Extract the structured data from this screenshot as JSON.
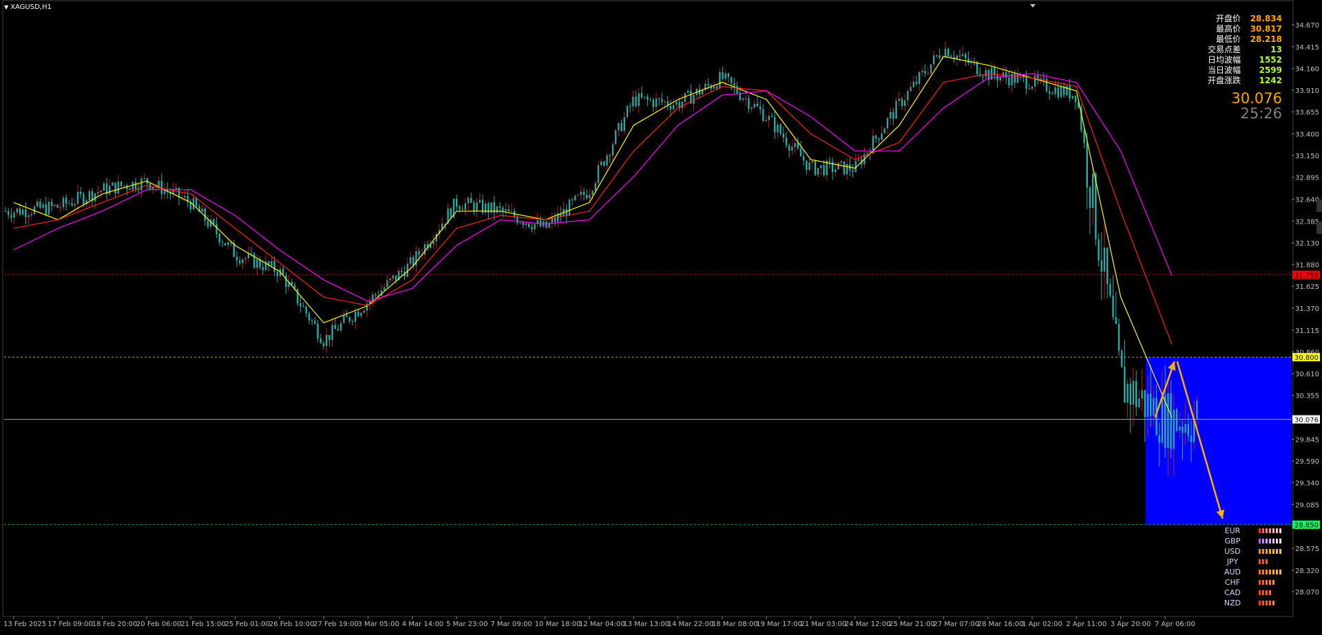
{
  "window": {
    "symbol_title": "XAGUSD,H1"
  },
  "info_panel": {
    "rows": [
      {
        "label": "开盘价",
        "value": "28.834",
        "tone": "orange"
      },
      {
        "label": "最高价",
        "value": "30.817",
        "tone": "orange"
      },
      {
        "label": "最低价",
        "value": "28.218",
        "tone": "orange"
      },
      {
        "label": "交易点差",
        "value": "13",
        "tone": "green"
      },
      {
        "label": "日均波幅",
        "value": "1552",
        "tone": "green"
      },
      {
        "label": "当日波幅",
        "value": "2599",
        "tone": "green"
      },
      {
        "label": "开盘涨跌",
        "value": "1242",
        "tone": "green"
      }
    ],
    "current_price": "30.076",
    "countdown": "25:26"
  },
  "price_axis": {
    "ticks": [
      "34.670",
      "34.415",
      "34.160",
      "33.910",
      "33.655",
      "33.400",
      "33.150",
      "32.895",
      "32.640",
      "32.385",
      "32.130",
      "31.880",
      "31.625",
      "31.370",
      "31.115",
      "30.860",
      "30.610",
      "30.355",
      "30.100",
      "29.845",
      "29.590",
      "29.340",
      "29.085",
      "28.830",
      "28.575",
      "28.320",
      "28.070"
    ],
    "tick_min": 28.07,
    "tick_max": 34.67,
    "range": [
      28.07,
      34.67
    ],
    "markers": [
      {
        "value": 31.759,
        "label": "31.759",
        "color": "#ff0000",
        "line": "#a01010"
      },
      {
        "value": 30.8,
        "label": "30.800",
        "color": "#ffff00",
        "line": "#c8b400"
      },
      {
        "value": 30.076,
        "label": "30.076",
        "color": "#ffffff",
        "line": "#a0a0a0"
      },
      {
        "value": 28.85,
        "label": "28.850",
        "color": "#00ff60",
        "line": "#20a040"
      }
    ]
  },
  "time_axis": {
    "labels": [
      "13 Feb 2025",
      "17 Feb 09:00",
      "18 Feb 20:00",
      "20 Feb 06:00",
      "21 Feb 15:00",
      "25 Feb 01:00",
      "26 Feb 10:00",
      "27 Feb 19:00",
      "3 Mar 05:00",
      "4 Mar 14:00",
      "5 Mar 23:00",
      "7 Mar 09:00",
      "10 Mar 18:00",
      "12 Mar 04:00",
      "13 Mar 13:00",
      "14 Mar 22:00",
      "18 Mar 08:00",
      "19 Mar 17:00",
      "21 Mar 03:00",
      "24 Mar 12:00",
      "25 Mar 21:00",
      "27 Mar 07:00",
      "28 Mar 16:00",
      "1 Apr 02:00",
      "2 Apr 11:00",
      "3 Apr 20:00",
      "7 Apr 06:00"
    ]
  },
  "colors": {
    "background": "#000000",
    "candle": "#20b2aa",
    "ma_fast": "#ffff00",
    "ma_mid": "#ff2020",
    "ma_slow": "#ff00ff",
    "zone": "#0000ff",
    "arrow": "#ffb000",
    "axis_text": "#c0c0c0"
  },
  "chart_data": {
    "type": "line",
    "symbol": "XAGUSD",
    "timeframe": "H1",
    "ylim": [
      28.07,
      34.67
    ],
    "series": [
      {
        "color": "#20b2aa",
        "x": [
          "13 Feb 2025",
          "17 Feb 09:00",
          "18 Feb 20:00",
          "20 Feb 06:00",
          "21 Feb 15:00",
          "25 Feb 01:00",
          "26 Feb 10:00",
          "27 Feb 19:00",
          "3 Mar 05:00",
          "4 Mar 14:00",
          "5 Mar 23:00",
          "7 Mar 09:00",
          "10 Mar 18:00",
          "12 Mar 04:00",
          "13 Mar 13:00",
          "14 Mar 22:00",
          "18 Mar 08:00",
          "19 Mar 17:00",
          "21 Mar 03:00",
          "24 Mar 12:00",
          "25 Mar 21:00",
          "27 Mar 07:00",
          "28 Mar 16:00",
          "1 Apr 02:00",
          "2 Apr 11:00",
          "3 Apr 20:00",
          "7 Apr 06:00"
        ],
        "y": [
          32.5,
          32.55,
          32.75,
          32.85,
          32.6,
          32.0,
          31.8,
          31.0,
          31.45,
          31.9,
          32.6,
          32.5,
          32.3,
          32.75,
          33.8,
          33.75,
          34.05,
          33.6,
          33.0,
          33.0,
          33.75,
          34.4,
          34.1,
          34.0,
          33.85,
          30.5,
          30.08
        ]
      },
      {
        "color": "#ffff00",
        "x": [
          "13 Feb 2025",
          "17 Feb 09:00",
          "18 Feb 20:00",
          "20 Feb 06:00",
          "21 Feb 15:00",
          "25 Feb 01:00",
          "26 Feb 10:00",
          "27 Feb 19:00",
          "3 Mar 05:00",
          "4 Mar 14:00",
          "5 Mar 23:00",
          "7 Mar 09:00",
          "10 Mar 18:00",
          "12 Mar 04:00",
          "13 Mar 13:00",
          "14 Mar 22:00",
          "18 Mar 08:00",
          "19 Mar 17:00",
          "21 Mar 03:00",
          "24 Mar 12:00",
          "25 Mar 21:00",
          "27 Mar 07:00",
          "28 Mar 16:00",
          "1 Apr 02:00",
          "2 Apr 11:00",
          "3 Apr 20:00",
          "7 Apr 06:00"
        ],
        "y": [
          32.6,
          32.4,
          32.7,
          32.85,
          32.6,
          32.1,
          31.8,
          31.2,
          31.4,
          31.85,
          32.5,
          32.5,
          32.4,
          32.6,
          33.5,
          33.8,
          34.0,
          33.8,
          33.1,
          33.0,
          33.5,
          34.3,
          34.2,
          34.05,
          33.9,
          31.5,
          30.1
        ]
      },
      {
        "color": "#ff2020",
        "x": [
          "13 Feb 2025",
          "17 Feb 09:00",
          "18 Feb 20:00",
          "20 Feb 06:00",
          "21 Feb 15:00",
          "25 Feb 01:00",
          "26 Feb 10:00",
          "27 Feb 19:00",
          "3 Mar 05:00",
          "4 Mar 14:00",
          "5 Mar 23:00",
          "7 Mar 09:00",
          "10 Mar 18:00",
          "12 Mar 04:00",
          "13 Mar 13:00",
          "14 Mar 22:00",
          "18 Mar 08:00",
          "19 Mar 17:00",
          "21 Mar 03:00",
          "24 Mar 12:00",
          "25 Mar 21:00",
          "27 Mar 07:00",
          "28 Mar 16:00",
          "1 Apr 02:00",
          "2 Apr 11:00",
          "3 Apr 20:00",
          "7 Apr 06:00"
        ],
        "y": [
          32.3,
          32.4,
          32.6,
          32.8,
          32.7,
          32.3,
          31.9,
          31.5,
          31.4,
          31.7,
          32.3,
          32.45,
          32.4,
          32.5,
          33.2,
          33.7,
          33.95,
          33.9,
          33.4,
          33.1,
          33.3,
          34.0,
          34.1,
          34.05,
          33.95,
          32.5,
          30.95
        ]
      },
      {
        "color": "#ff00ff",
        "x": [
          "13 Feb 2025",
          "17 Feb 09:00",
          "18 Feb 20:00",
          "20 Feb 06:00",
          "21 Feb 15:00",
          "25 Feb 01:00",
          "26 Feb 10:00",
          "27 Feb 19:00",
          "3 Mar 05:00",
          "4 Mar 14:00",
          "5 Mar 23:00",
          "7 Mar 09:00",
          "10 Mar 18:00",
          "12 Mar 04:00",
          "13 Mar 13:00",
          "14 Mar 22:00",
          "18 Mar 08:00",
          "19 Mar 17:00",
          "21 Mar 03:00",
          "24 Mar 12:00",
          "25 Mar 21:00",
          "27 Mar 07:00",
          "28 Mar 16:00",
          "1 Apr 02:00",
          "2 Apr 11:00",
          "3 Apr 20:00",
          "7 Apr 06:00"
        ],
        "y": [
          32.05,
          32.3,
          32.5,
          32.75,
          32.75,
          32.45,
          32.05,
          31.7,
          31.45,
          31.6,
          32.1,
          32.4,
          32.35,
          32.4,
          32.9,
          33.5,
          33.85,
          33.9,
          33.6,
          33.2,
          33.2,
          33.7,
          34.05,
          34.1,
          34.0,
          33.2,
          31.75
        ]
      }
    ],
    "zone": {
      "from": 28.85,
      "to": 30.8,
      "start_x": "3 Apr 20:00"
    },
    "forecast_arrows": [
      {
        "from": 30.1,
        "to": 30.75
      },
      {
        "from": 30.75,
        "to": 28.92
      }
    ],
    "grid": false
  },
  "currency_strength": [
    {
      "name": "EUR",
      "bars": [
        "#ff3030",
        "#ff6060",
        "#ff8080",
        "#ff9090",
        "#ffb0b0",
        "#ffc0c0",
        "#ffd0d0"
      ]
    },
    {
      "name": "GBP",
      "bars": [
        "#b060ff",
        "#c080ff",
        "#d0a0ff",
        "#d8b0ff",
        "#e0c0ff",
        "#ecd8ff",
        "#f4e8ff"
      ]
    },
    {
      "name": "USD",
      "bars": [
        "#ff8c00",
        "#ff9a10",
        "#ffa020",
        "#ffa830",
        "#ffb040",
        "#ffb850",
        "#ffc060"
      ]
    },
    {
      "name": "JPY",
      "bars": [
        "#ff4040",
        "#ff5020",
        "#ff6010"
      ]
    },
    {
      "name": "AUD",
      "bars": [
        "#ff7000",
        "#ff8000",
        "#ff8c10",
        "#ff9820",
        "#ffa430",
        "#ffb040",
        "#ffbc50"
      ]
    },
    {
      "name": "CHF",
      "bars": [
        "#ff5000",
        "#ff6010",
        "#ff7020",
        "#ff8030",
        "#ff9040"
      ]
    },
    {
      "name": "CAD",
      "bars": [
        "#ff4000",
        "#ff5010",
        "#ff6020",
        "#ff7030"
      ]
    },
    {
      "name": "NZD",
      "bars": [
        "#ff4000",
        "#ff5010",
        "#ff6020",
        "#ff7030",
        "#ff8040"
      ]
    }
  ]
}
